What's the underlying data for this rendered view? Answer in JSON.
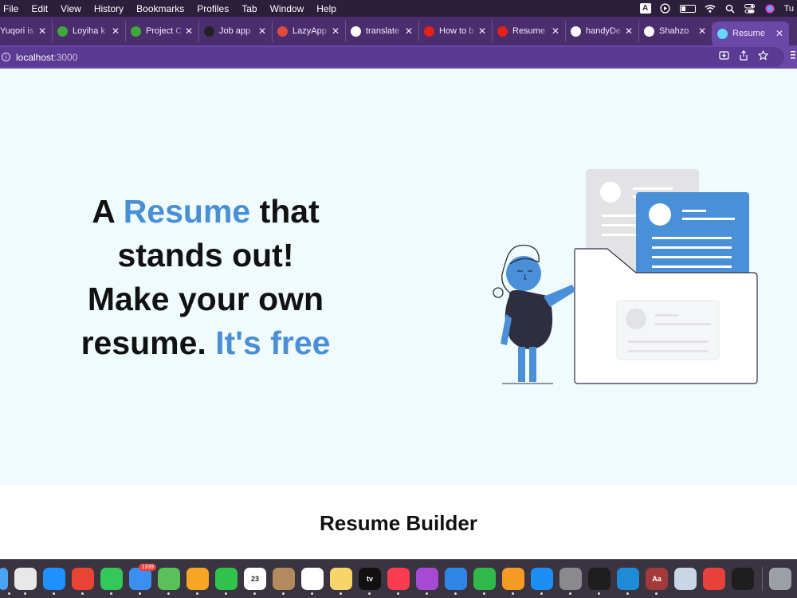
{
  "menubar": {
    "items": [
      "File",
      "Edit",
      "View",
      "History",
      "Bookmarks",
      "Profiles",
      "Tab",
      "Window",
      "Help"
    ],
    "input_indicator": "A",
    "user_initials": "Tu"
  },
  "tabs": [
    {
      "title": "Yuqori is",
      "favicon": "generic-icon",
      "color": "#cccccc"
    },
    {
      "title": "Loyiha k",
      "favicon": "upwork-icon",
      "color": "#3fa83a"
    },
    {
      "title": "Project C",
      "favicon": "upwork-icon",
      "color": "#3fa83a"
    },
    {
      "title": "Job app",
      "favicon": "job-icon",
      "color": "#222222"
    },
    {
      "title": "LazyApp",
      "favicon": "calendar-icon",
      "color": "#e04b3a"
    },
    {
      "title": "translate",
      "favicon": "google-icon",
      "color": "#ffffff"
    },
    {
      "title": "How to b",
      "favicon": "youtube-icon",
      "color": "#e62117"
    },
    {
      "title": "Resume",
      "favicon": "youtube-icon",
      "color": "#e62117"
    },
    {
      "title": "handyDe",
      "favicon": "github-icon",
      "color": "#ffffff"
    },
    {
      "title": "Shahzo",
      "favicon": "github-icon",
      "color": "#ffffff"
    },
    {
      "title": "Resume",
      "favicon": "react-icon",
      "color": "#61dafb",
      "active": true
    }
  ],
  "address": {
    "host": "localhost",
    "port": ":3000"
  },
  "hero": {
    "line1_a": "A ",
    "line1_highlight": "Resume",
    "line1_b": " that",
    "line2": "stands out!",
    "line3": "Make your own",
    "line4_a": "resume. ",
    "line4_highlight": "It's free",
    "accent_color": "#4a8fd6",
    "background": "#effbfd"
  },
  "section": {
    "title": "Resume Builder"
  },
  "dock": {
    "apps": [
      {
        "name": "finder-icon",
        "color": "#4aa3f0"
      },
      {
        "name": "launchpad-icon",
        "color": "#e8e8e8"
      },
      {
        "name": "safari-icon",
        "color": "#1e90ff"
      },
      {
        "name": "chrome-icon",
        "color": "#e94335"
      },
      {
        "name": "messages-icon",
        "color": "#34c759"
      },
      {
        "name": "mail-icon",
        "color": "#3b8ff0",
        "badge": "1339"
      },
      {
        "name": "maps-icon",
        "color": "#5ac05a"
      },
      {
        "name": "photos-icon",
        "color": "#f5a623"
      },
      {
        "name": "facetime-icon",
        "color": "#30c24a"
      },
      {
        "name": "calendar-icon",
        "color": "#ffffff",
        "label": "23"
      },
      {
        "name": "contacts-icon",
        "color": "#b28a5e"
      },
      {
        "name": "reminders-icon",
        "color": "#ffffff"
      },
      {
        "name": "notes-icon",
        "color": "#f7d568"
      },
      {
        "name": "appletv-icon",
        "color": "#111111",
        "label": "tv"
      },
      {
        "name": "music-icon",
        "color": "#fa3c50"
      },
      {
        "name": "podcasts-icon",
        "color": "#a64ad6"
      },
      {
        "name": "keynote-icon",
        "color": "#2f86e6"
      },
      {
        "name": "numbers-icon",
        "color": "#30b94b"
      },
      {
        "name": "pages-icon",
        "color": "#f59a23"
      },
      {
        "name": "appstore-icon",
        "color": "#1c8ef5"
      },
      {
        "name": "system-settings-icon",
        "color": "#8a8a8e"
      },
      {
        "name": "terminal-icon",
        "color": "#1e1e1e"
      },
      {
        "name": "vscode-icon",
        "color": "#1f8ad6"
      },
      {
        "name": "dictionary-icon",
        "color": "#a23a3a",
        "label": "Aa"
      },
      {
        "name": "preview-icon",
        "color": "#c9d6e6"
      },
      {
        "name": "anydesk-icon",
        "color": "#e8403a"
      },
      {
        "name": "figma-icon",
        "color": "#1e1e1e"
      },
      {
        "name": "trash-icon",
        "color": "#9aa0a6"
      }
    ]
  }
}
